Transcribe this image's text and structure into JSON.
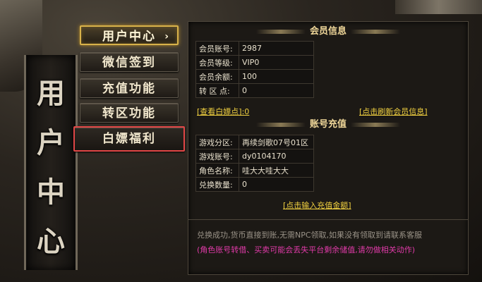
{
  "vertical_title": [
    "用",
    "户",
    "中",
    "心"
  ],
  "menu": {
    "items": [
      {
        "label": "用户中心",
        "chevron": "›"
      },
      {
        "label": "微信签到"
      },
      {
        "label": "充值功能"
      },
      {
        "label": "转区功能"
      },
      {
        "label": "白嫖福利"
      }
    ]
  },
  "member": {
    "title": "会员信息",
    "rows": [
      {
        "key": "会员账号:",
        "value": "2987"
      },
      {
        "key": "会员等级:",
        "value": "VIP0"
      },
      {
        "key": "会员余额:",
        "value": "100"
      },
      {
        "key": "转 区 点:",
        "value": "0"
      }
    ],
    "view_points_link": "[查看白嫖点]:0",
    "refresh_link": "[点击刷新会员信息]"
  },
  "recharge": {
    "title": "账号充值",
    "rows": [
      {
        "key": "游戏分区:",
        "value": "再续剑歌07号01区"
      },
      {
        "key": "游戏账号:",
        "value": "dy0104170"
      },
      {
        "key": "角色名称:",
        "value": "哇大大哇大大"
      },
      {
        "key": "兑换数量:",
        "value": "0"
      }
    ],
    "input_amount_link": "[点击输入充值金额]"
  },
  "notes": {
    "info": "兑换成功,货币直接到账,无需NPC领取,如果没有领取到请联系客服",
    "warning": "(角色账号转借、买卖可能会丢失平台剩余储值,请勿做相关动作)"
  },
  "colors": {
    "gold": "#f0d040",
    "red": "#e0605a",
    "cyan": "#5cc8d6",
    "green": "#5ad84a",
    "pink": "#e03aa8",
    "highlight_border": "#e04646"
  }
}
